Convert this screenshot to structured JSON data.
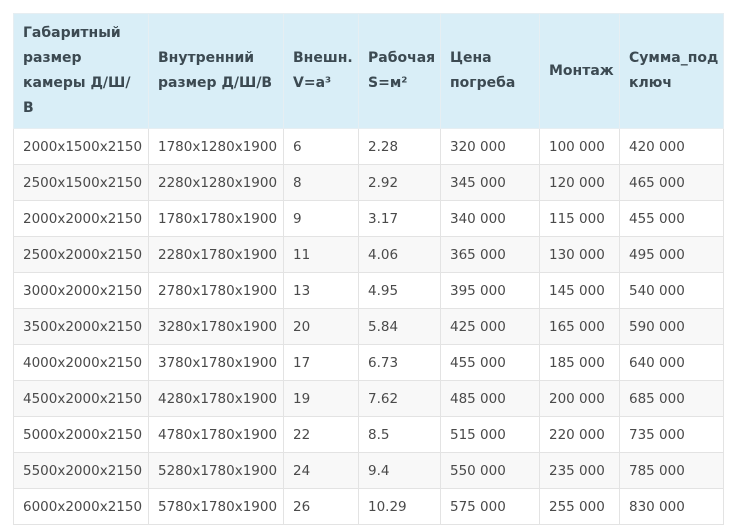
{
  "table": {
    "headers": [
      "Габаритный размер камеры Д/Ш/В",
      "Внутренний размер Д/Ш/В",
      "Внешн. V=a³",
      "Рабочая S=м²",
      "Цена погреба",
      "Монтаж",
      "Сумма_под ключ"
    ],
    "rows": [
      [
        "2000x1500x2150",
        "1780x1280x1900",
        "6",
        "2.28",
        "320 000",
        "100 000",
        "420 000"
      ],
      [
        "2500x1500x2150",
        "2280x1280x1900",
        "8",
        "2.92",
        "345 000",
        "120 000",
        "465 000"
      ],
      [
        "2000x2000x2150",
        "1780x1780x1900",
        "9",
        "3.17",
        "340 000",
        "115 000",
        "455 000"
      ],
      [
        "2500x2000x2150",
        "2280x1780x1900",
        "11",
        "4.06",
        "365 000",
        "130 000",
        "495 000"
      ],
      [
        "3000x2000x2150",
        "2780x1780x1900",
        "13",
        "4.95",
        "395 000",
        "145 000",
        "540 000"
      ],
      [
        "3500x2000x2150",
        "3280x1780x1900",
        "20",
        "5.84",
        "425 000",
        "165 000",
        "590 000"
      ],
      [
        "4000x2000x2150",
        "3780x1780x1900",
        "17",
        "6.73",
        "455 000",
        "185 000",
        "640 000"
      ],
      [
        "4500x2000x2150",
        "4280x1780x1900",
        "19",
        "7.62",
        "485 000",
        "200 000",
        "685 000"
      ],
      [
        "5000x2000x2150",
        "4780x1780x1900",
        "22",
        "8.5",
        "515 000",
        "220 000",
        "735 000"
      ],
      [
        "5500x2000x2150",
        "5280x1780x1900",
        "24",
        "9.4",
        "550 000",
        "235 000",
        "785 000"
      ],
      [
        "6000x2000x2150",
        "5780x1780x1900",
        "26",
        "10.29",
        "575 000",
        "255 000",
        "830 000"
      ]
    ]
  },
  "colors": {
    "header_bg": "#d9eef7",
    "header_text": "#3c4a52",
    "cell_text": "#4a4a4a",
    "border": "#e3e3e3",
    "stripe": "#f8f8f8"
  }
}
